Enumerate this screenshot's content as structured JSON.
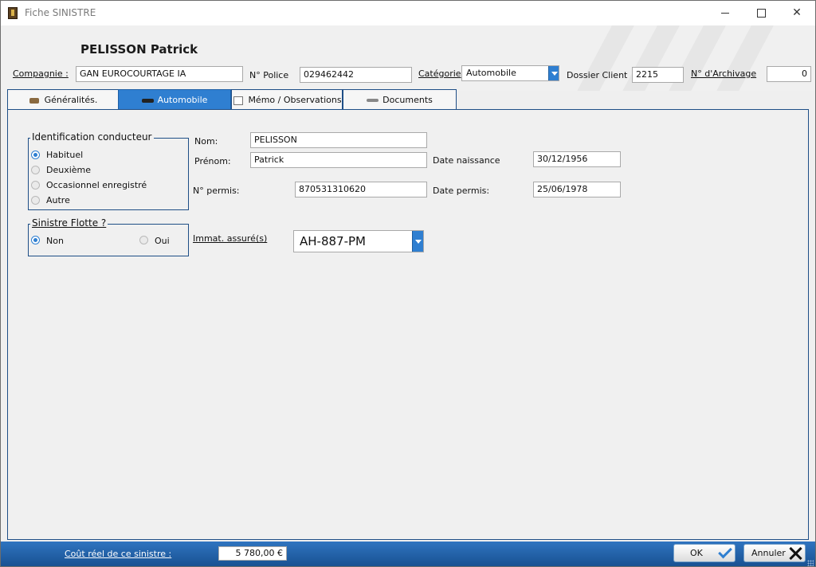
{
  "window": {
    "title": "Fiche SINISTRE"
  },
  "header": {
    "client_name": "PELISSON Patrick",
    "compagnie_label": "Compagnie :",
    "compagnie_value": "GAN EUROCOURTAGE IA",
    "police_label": "N° Police",
    "police_value": "029462442",
    "categorie_label": "Catégorie",
    "categorie_value": "Automobile",
    "dossier_label": "Dossier Client",
    "dossier_value": "2215",
    "archivage_label": "N° d'Archivage",
    "archivage_value": "0"
  },
  "tabs": [
    {
      "label": "Généralités.",
      "active": false
    },
    {
      "label": "Automobile",
      "active": true
    },
    {
      "label": "Mémo / Observations",
      "active": false
    },
    {
      "label": "Documents numérisés",
      "active": false
    }
  ],
  "identification": {
    "title": "Identification conducteur",
    "options": [
      "Habituel",
      "Deuxième",
      "Occasionnel enregistré",
      "Autre"
    ],
    "selected": "Habituel"
  },
  "flotte": {
    "title": "Sinistre Flotte ?",
    "options": [
      "Non",
      "Oui"
    ],
    "selected": "Non"
  },
  "conducteur": {
    "nom_label": "Nom:",
    "nom_value": "PELISSON",
    "prenom_label": "Prénom:",
    "prenom_value": "Patrick",
    "naissance_label": "Date naissance",
    "naissance_value": "30/12/1956",
    "permis_label": "N° permis:",
    "permis_value": "870531310620",
    "date_permis_label": "Date permis:",
    "date_permis_value": "25/06/1978",
    "immat_label": "Immat. assuré(s)",
    "immat_value": "AH-887-PM"
  },
  "footer": {
    "cost_label": "Coût réel de ce sinistre :",
    "cost_value": "5 780,00 €",
    "ok_label": "OK",
    "cancel_label": "Annuler"
  },
  "colors": {
    "accent": "#2f7fd1",
    "footer": "#1f5fa5",
    "border": "#1e4e86"
  }
}
